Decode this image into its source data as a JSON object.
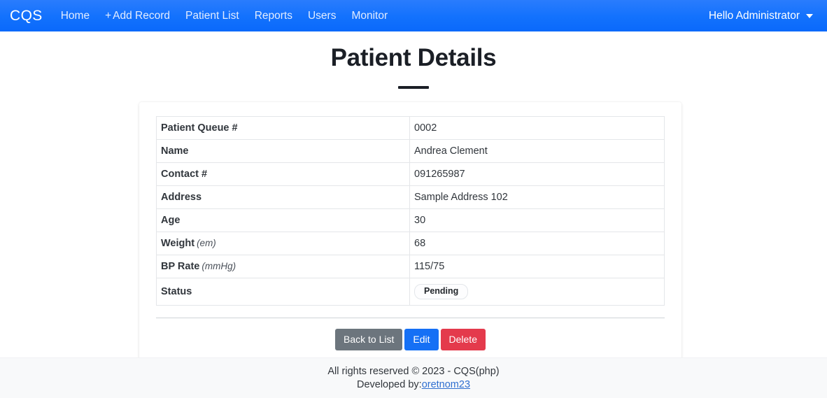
{
  "navbar": {
    "brand": "CQS",
    "links": [
      {
        "label": "Home",
        "name": "nav-link-home"
      },
      {
        "plus": "+",
        "label": "Add Record",
        "name": "nav-link-add-record"
      },
      {
        "label": "Patient List",
        "name": "nav-link-patient-list"
      },
      {
        "label": "Reports",
        "name": "nav-link-reports"
      },
      {
        "label": "Users",
        "name": "nav-link-users"
      },
      {
        "label": "Monitor",
        "name": "nav-link-monitor"
      }
    ],
    "user_greeting": "Hello Administrator",
    "caret_icon": "chevron-down-icon",
    "accent_color": "#1372fd"
  },
  "page": {
    "title": "Patient Details"
  },
  "details": {
    "rows": [
      {
        "label": "Patient Queue #",
        "unit": "",
        "value": "0002"
      },
      {
        "label": "Name",
        "unit": "",
        "value": "Andrea Clement"
      },
      {
        "label": "Contact #",
        "unit": "",
        "value": "091265987"
      },
      {
        "label": "Address",
        "unit": "",
        "value": "Sample Address 102"
      },
      {
        "label": "Age",
        "unit": "",
        "value": "30"
      },
      {
        "label": "Weight",
        "unit": "(em)",
        "value": "68"
      },
      {
        "label": "BP Rate",
        "unit": "(mmHg)",
        "value": "115/75"
      }
    ],
    "status_label": "Status",
    "status_value": "Pending"
  },
  "actions": {
    "back_label": "Back to List",
    "edit_label": "Edit",
    "delete_label": "Delete",
    "back_color": "#6c757d",
    "edit_color": "#1570f5",
    "delete_color": "#e43a4c"
  },
  "footer": {
    "line1": "All rights reserved © 2023 - CQS(php)",
    "line2_prefix": "Developed by:",
    "link_text": "oretnom23"
  }
}
